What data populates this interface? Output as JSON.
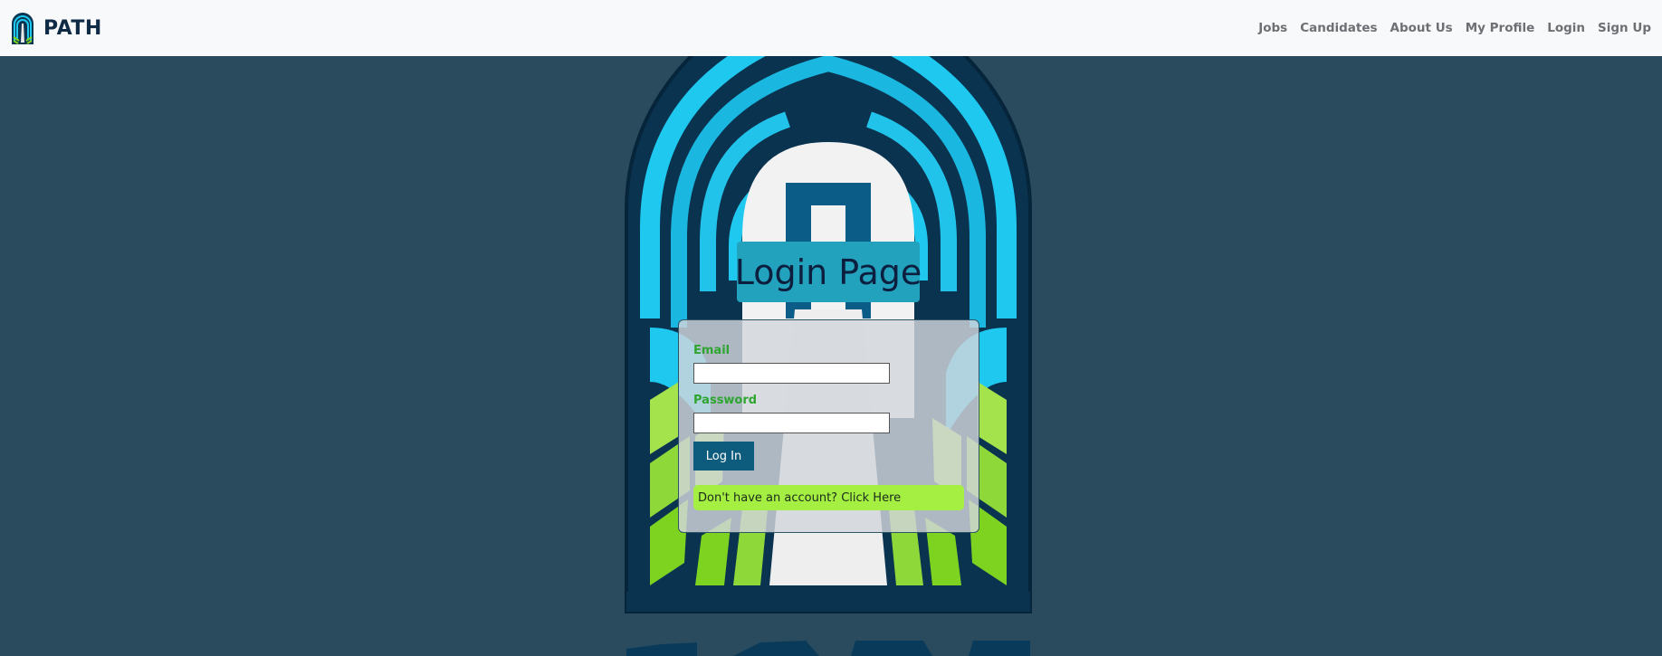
{
  "navbar": {
    "brand": "PATH",
    "links": [
      {
        "label": "Jobs"
      },
      {
        "label": "Candidates"
      },
      {
        "label": "About Us"
      },
      {
        "label": "My Profile"
      },
      {
        "label": "Login"
      },
      {
        "label": "Sign Up"
      }
    ]
  },
  "page": {
    "title": "Login Page"
  },
  "form": {
    "email_label": "Email",
    "email_value": "",
    "password_label": "Password",
    "password_value": "",
    "login_button": "Log In",
    "signup_prompt": "Don't have an account? Click Here"
  },
  "colors": {
    "background": "#294b5d",
    "navbar": "#f8f9fa",
    "title_bg": "#22a2bd",
    "label_green": "#2fa531",
    "button": "#0e5c7d",
    "signup_bg": "#a5ef42",
    "logo_blue": "#1ec8ef",
    "logo_green": "#7ed321"
  }
}
